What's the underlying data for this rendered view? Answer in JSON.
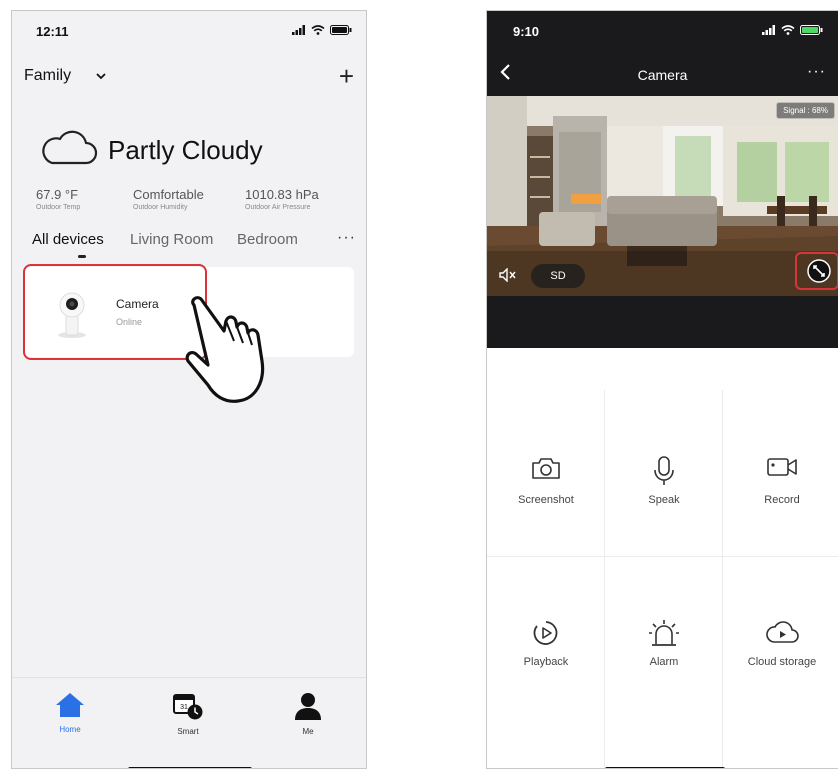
{
  "left": {
    "status_time": "12:11",
    "family_title": "Family",
    "add_label": "+",
    "weather": "Partly Cloudy",
    "stats": [
      {
        "value": "67.9 °F",
        "label": "Outdoor Temp"
      },
      {
        "value": "Comfortable",
        "label": "Outdoor Humidity"
      },
      {
        "value": "1010.83 hPa",
        "label": "Outdoor Air Pressure"
      }
    ],
    "tabs": [
      "All devices",
      "Living Room",
      "Bedroom"
    ],
    "tabs_more": "···",
    "device": {
      "name": "Camera",
      "status": "Online"
    },
    "nav": [
      {
        "label": "Home"
      },
      {
        "label": "Smart"
      },
      {
        "label": "Me"
      }
    ],
    "calendar_day": "31"
  },
  "right": {
    "status_time": "9:10",
    "title": "Camera",
    "more": "···",
    "signal": "Signal : 68%",
    "sd_label": "SD",
    "actions": [
      {
        "label": "Screenshot",
        "icon": "camera-icon"
      },
      {
        "label": "Speak",
        "icon": "microphone-icon"
      },
      {
        "label": "Record",
        "icon": "video-camera-icon"
      },
      {
        "label": "Playback",
        "icon": "playback-icon"
      },
      {
        "label": "Alarm",
        "icon": "alarm-icon"
      },
      {
        "label": "Cloud storage",
        "icon": "cloud-play-icon"
      }
    ]
  },
  "colors": {
    "accent_blue": "#2a71e6",
    "highlight_red": "#d8343a",
    "dark_header": "#1a1a1c"
  }
}
